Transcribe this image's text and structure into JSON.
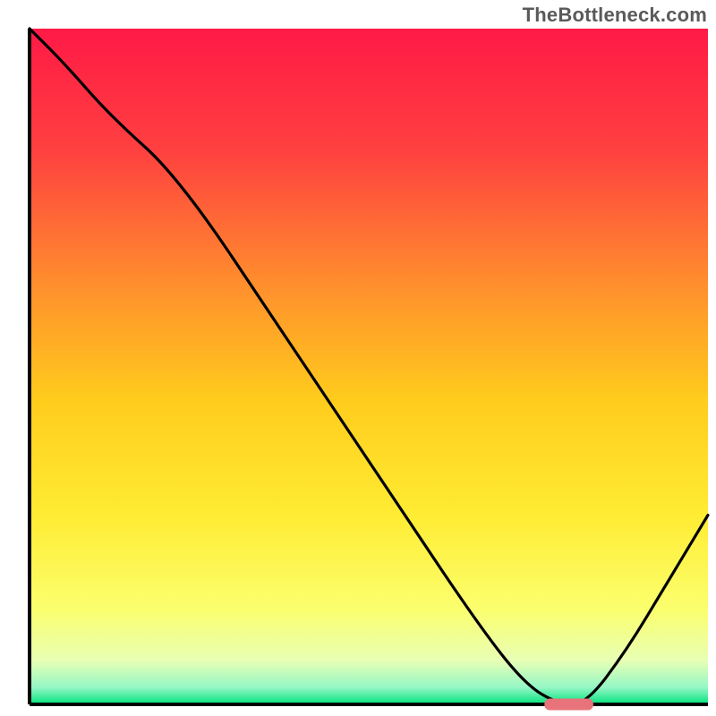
{
  "attribution": "TheBottleneck.com",
  "colors": {
    "curve_stroke": "#000000",
    "axis_stroke": "#000000",
    "marker_fill": "#e8737a",
    "gradient_stops": [
      {
        "offset": 0.0,
        "color": "#ff1a46"
      },
      {
        "offset": 0.18,
        "color": "#ff4040"
      },
      {
        "offset": 0.38,
        "color": "#ff8f2d"
      },
      {
        "offset": 0.55,
        "color": "#ffcc1c"
      },
      {
        "offset": 0.72,
        "color": "#ffec33"
      },
      {
        "offset": 0.86,
        "color": "#fbff6e"
      },
      {
        "offset": 0.935,
        "color": "#e8ffb4"
      },
      {
        "offset": 0.975,
        "color": "#95f7c6"
      },
      {
        "offset": 1.0,
        "color": "#00e27b"
      }
    ]
  },
  "chart_data": {
    "type": "line",
    "title": "",
    "xlabel": "",
    "ylabel": "",
    "xlim": [
      0,
      100
    ],
    "ylim": [
      0,
      100
    ],
    "x": [
      0,
      5,
      12,
      22,
      38,
      54,
      66,
      73,
      78,
      82,
      88,
      94,
      100
    ],
    "values": [
      100,
      95,
      87,
      78,
      54,
      30,
      12,
      3,
      0,
      0,
      8,
      18,
      28
    ],
    "flat_minimum_x_range": [
      76.5,
      82.5
    ],
    "marker": {
      "x_center": 79.5,
      "width": 7.2
    }
  }
}
